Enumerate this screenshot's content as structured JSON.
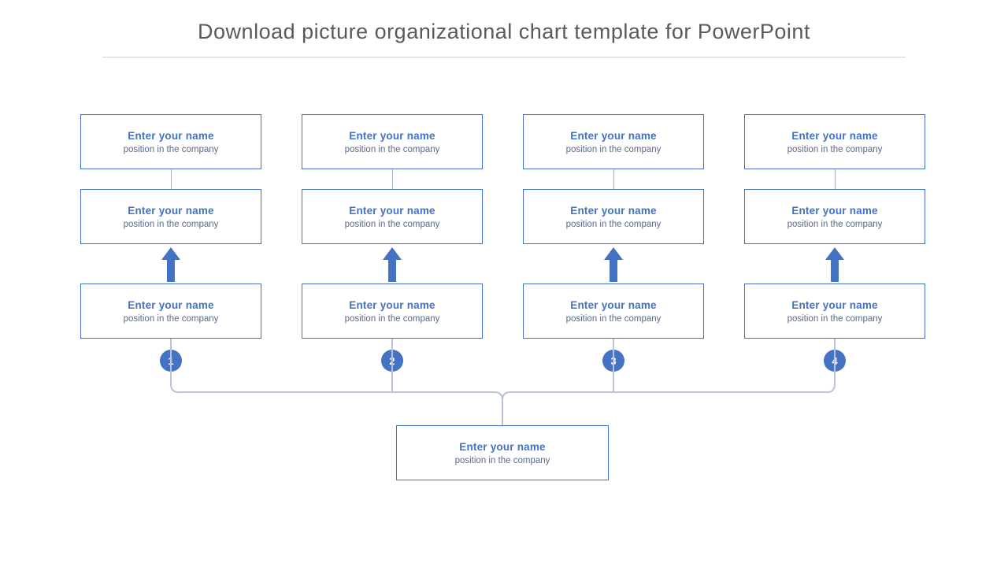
{
  "title": "Download picture organizational chart template for PowerPoint",
  "card": {
    "name": "Enter your name",
    "position": "position in the company"
  },
  "badges": [
    "1",
    "2",
    "3",
    "4"
  ],
  "colors": {
    "accent": "#4472c4",
    "line": "#b9c2d8"
  }
}
